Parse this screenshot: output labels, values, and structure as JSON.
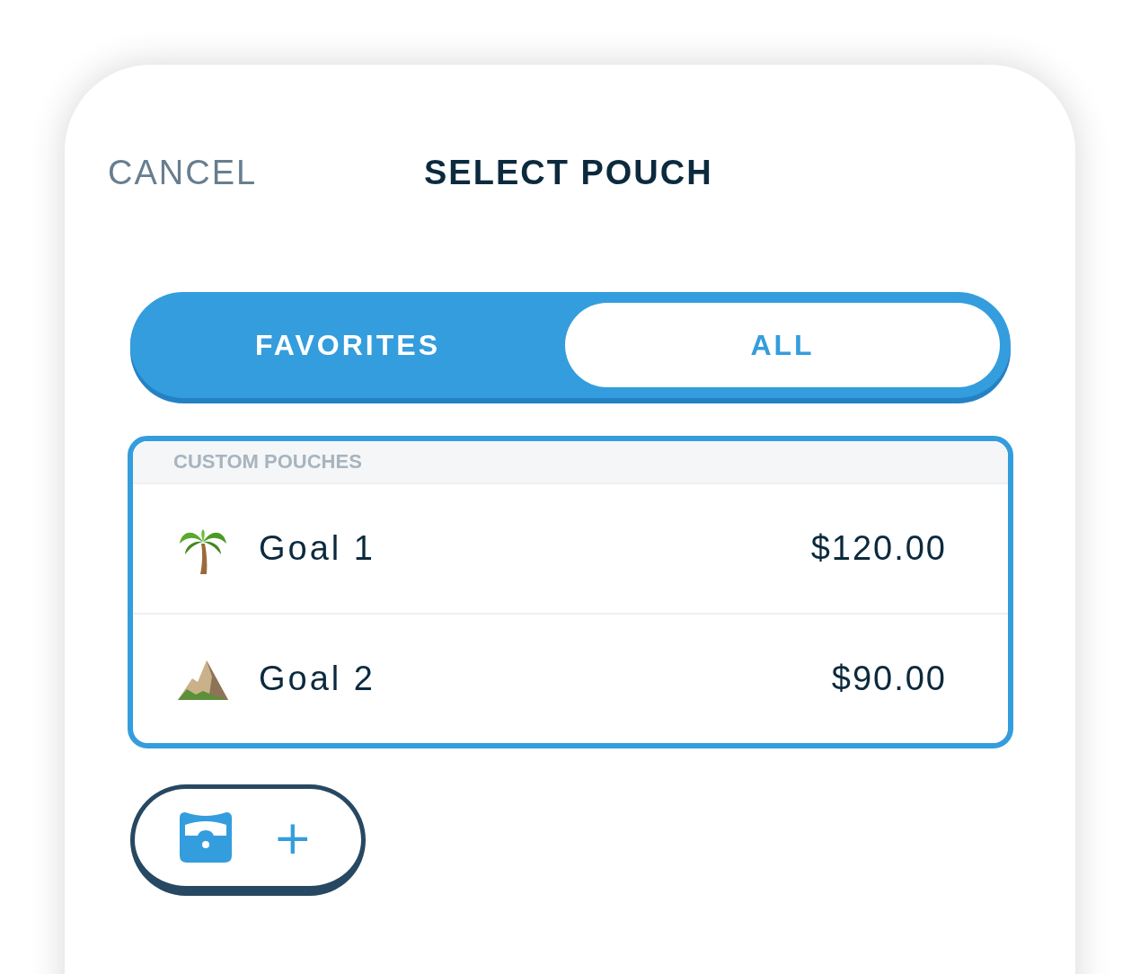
{
  "header": {
    "cancel": "CANCEL",
    "title": "SELECT POUCH"
  },
  "tabs": [
    {
      "label": "FAVORITES",
      "selected": true
    },
    {
      "label": "ALL",
      "selected": false
    }
  ],
  "list": {
    "section": "CUSTOM POUCHES",
    "items": [
      {
        "kind": "palm",
        "name": "Goal 1",
        "amount": "$120.00"
      },
      {
        "kind": "mountain",
        "name": "Goal 2",
        "amount": "$90.00"
      }
    ]
  },
  "add_button": {
    "plus": "+"
  }
}
